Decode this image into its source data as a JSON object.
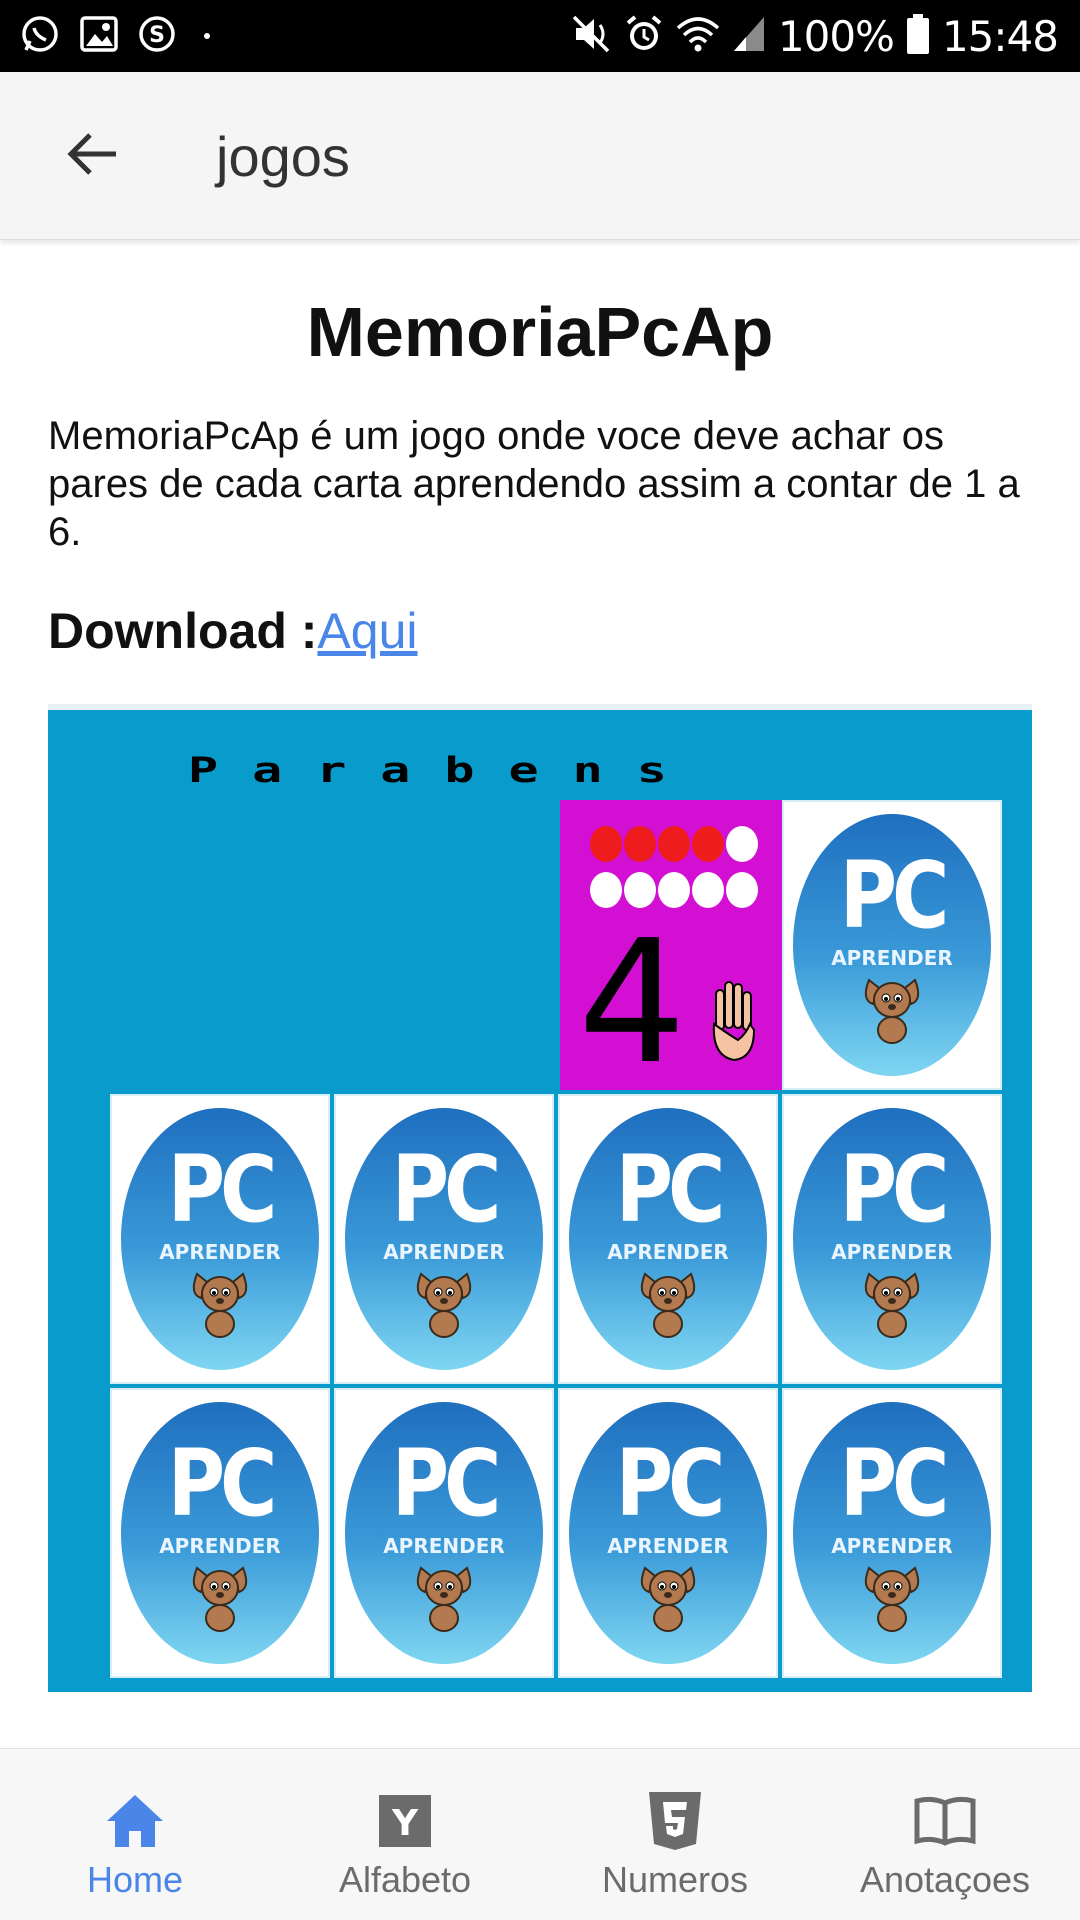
{
  "status_bar": {
    "battery_text": "100%",
    "time": "15:48",
    "left_icons": [
      "whatsapp-icon",
      "gallery-icon",
      "skype-icon",
      "dot-icon"
    ],
    "right_icons": [
      "mute-icon",
      "alarm-icon",
      "wifi-icon",
      "signal-icon",
      "battery-icon"
    ]
  },
  "app_bar": {
    "title": "jogos",
    "back_icon": "arrow-left-icon"
  },
  "article": {
    "title": "MemoriaPcAp",
    "description": "MemoriaPcAp é um jogo onde voce deve achar os pares de cada carta aprendendo assim a contar de 1 a 6.",
    "download_label": "Download :",
    "download_link": "Aqui"
  },
  "game_image": {
    "banner_text": "Parabens",
    "card_logo_text": "PC",
    "card_logo_sub": "APRENDER",
    "revealed_number": "4",
    "colors": {
      "background": "#0a9bcd",
      "revealed_card": "#d40fd4",
      "dot_filled": "#ee1c1c",
      "dot_empty": "#ffffff"
    }
  },
  "bottom_nav": {
    "items": [
      {
        "label": "Home",
        "icon": "home-icon",
        "active": true
      },
      {
        "label": "Alfabeto",
        "icon": "alphabet-y-icon",
        "active": false
      },
      {
        "label": "Numeros",
        "icon": "html5-icon",
        "active": false
      },
      {
        "label": "Anotaçoes",
        "icon": "book-icon",
        "active": false
      }
    ],
    "active_color": "#4a86e8",
    "inactive_color": "#6b6b6b"
  }
}
